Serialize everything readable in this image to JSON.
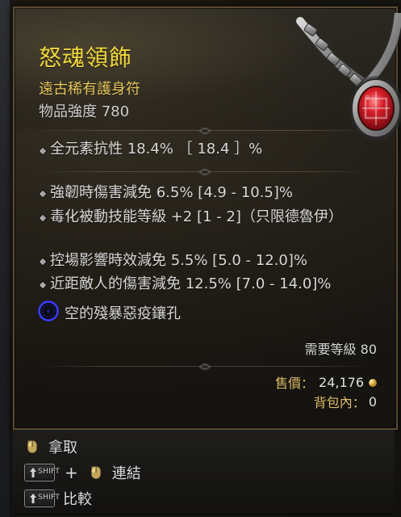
{
  "tooltip": {
    "item_name": "怒魂領飾",
    "item_type": "遠古稀有護身符",
    "item_power": "物品強度 780",
    "affixes": [
      {
        "text": "全元素抗性 18.4% ［ 18.4 ］%"
      },
      {
        "text": "強韌時傷害減免 6.5% [4.9 - 10.5]%"
      },
      {
        "text": "毒化被動技能等級 +2 [1 - 2]（只限德魯伊）"
      },
      {
        "text": "控場影響時效減免 5.5% [5.0 - 12.0]%"
      },
      {
        "text": "近距敵人的傷害減免 12.5% [7.0 - 14.0]%"
      }
    ],
    "socket_text": "空的殘暴惡疫鑲孔",
    "required_level": "需要等級 80",
    "sell_price_label": "售價：",
    "sell_price_value": "24,176",
    "bag_label": "背包內：",
    "bag_value": "0",
    "colors": {
      "name": "#f1d83b",
      "type": "#e6c75c",
      "text": "#d8d8d8",
      "price_label": "#e0c06b",
      "socket_ring": "#3b3bff"
    }
  },
  "actions": {
    "pickup": {
      "label": "拿取",
      "icon": "mouse-icon"
    },
    "link": {
      "modifier_key": "SHIFT",
      "plus": "+",
      "label": "連結",
      "icon": "mouse-icon"
    },
    "compare": {
      "modifier_key": "SHIFT",
      "label": "比較"
    }
  }
}
